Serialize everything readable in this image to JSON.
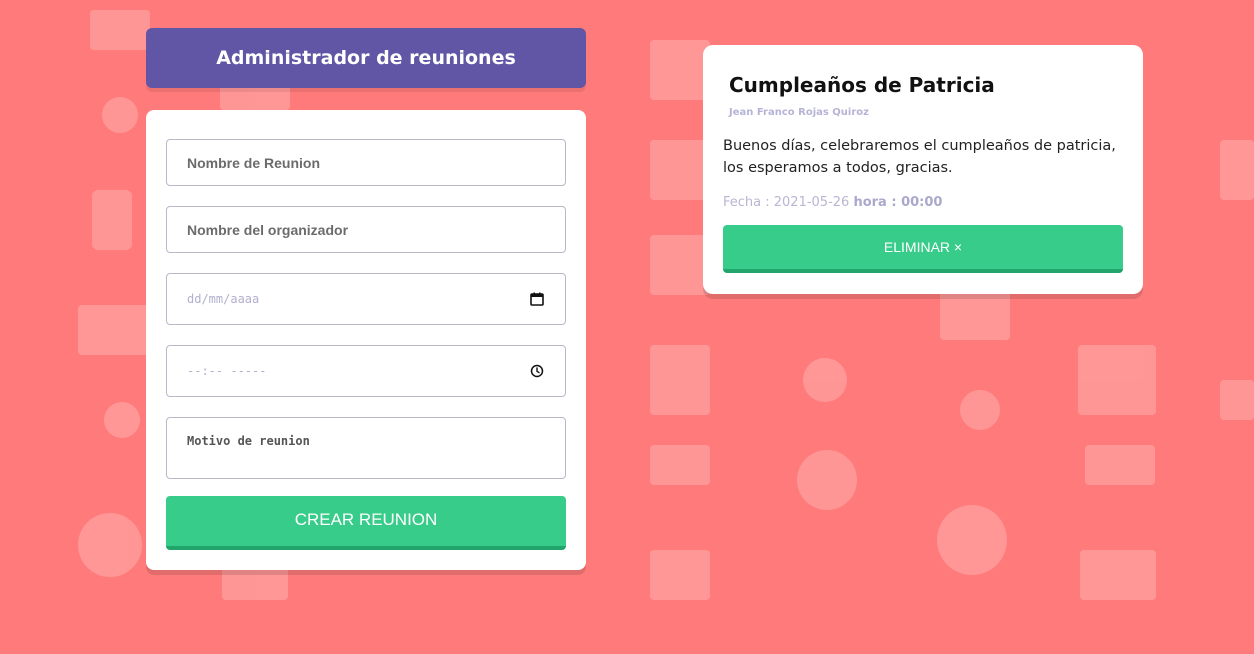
{
  "colors": {
    "background": "#ff7b7b",
    "header": "#6155a6",
    "accent_button": "#38cc8a",
    "card": "#ffffff"
  },
  "header": {
    "title": "Administrador de reuniones"
  },
  "form": {
    "meeting_name_placeholder": "Nombre de Reunion",
    "organizer_placeholder": "Nombre del organizador",
    "date_placeholder": "dd/mm/aaaa",
    "time_placeholder": "--:-- -----",
    "reason_placeholder": "Motivo de reunion",
    "submit_label": "CREAR REUNION",
    "date_icon": "calendar-icon",
    "time_icon": "clock-icon"
  },
  "meetings": [
    {
      "title": "Cumpleaños de Patricia",
      "organizer": "Jean Franco Rojas Quiroz",
      "description": "Buenos días, celebraremos el cumpleaños de patricia, los esperamos a todos, gracias.",
      "date_label": "Fecha : 2021-05-26",
      "time_label": "hora : 00:00",
      "delete_label": "ELIMINAR ×"
    }
  ]
}
